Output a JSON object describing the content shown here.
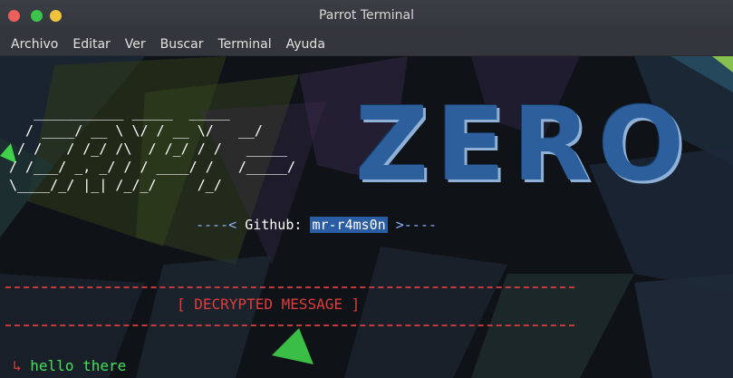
{
  "window": {
    "title": "Parrot Terminal"
  },
  "menubar": {
    "items": [
      "Archivo",
      "Editar",
      "Ver",
      "Buscar",
      "Terminal",
      "Ayuda"
    ]
  },
  "terminal": {
    "ascii_banner": "   ___________ _____  _____\n  / ____/ __ \\ \\/ / __ \\/   __/\n / /   / /_/ /\\  / /_/ / /   _____\n/ /___/ _, _/ / / ____/ /   /_____/\n\\____/_/ |_| /_/_/     /_/",
    "banner_word": "ZERO",
    "github_prefix": "----< ",
    "github_label": "Github: ",
    "github_user": "mr-r4ms0n",
    "github_suffix": " >----",
    "decrypted_header": "[ DECRYPTED MESSAGE ]",
    "prompt_arrow": "↳",
    "message": "hello there"
  },
  "colors": {
    "accent_red": "#e03c3c",
    "accent_green": "#44e05a",
    "zero_blue": "#2c5f9c",
    "highlight_blue": "#2b5da3"
  }
}
